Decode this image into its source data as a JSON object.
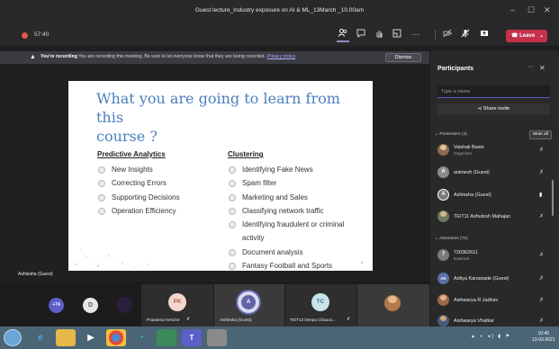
{
  "window": {
    "title": "Guest lecture_Industry exposure on AI & ML_13March _10.00am",
    "minimize": "–",
    "maximize": "☐",
    "close": "✕"
  },
  "toolbar": {
    "timer": "57:40",
    "more": "···",
    "leave_label": "Leave"
  },
  "banner": {
    "bold": "You're recording",
    "text": "You are recording this meeting. Be sure to let everyone know that they are being recorded.",
    "link": "Privacy policy",
    "dismiss": "Dismiss"
  },
  "slide": {
    "title_line1": "What you are going to learn from this",
    "title_line2": "course ?",
    "left_heading": "Predictive Analytics",
    "left_items": [
      "New Insights",
      "Correcting Errors",
      "Supporting Decisions",
      "Operation Efficiency"
    ],
    "right_heading": "Clustering",
    "right_items": [
      "Identifying Fake News",
      "Spam filter",
      "Marketing and Sales",
      "Classifying network traffic",
      "Identifying fraudulent or criminal activity",
      "Document analysis",
      "Fantasy Football and Sports"
    ],
    "page_number": "4"
  },
  "stage": {
    "presenter_label": "Ashlesha (Guest)"
  },
  "strip": {
    "overflow_count": "+74",
    "initial_d": "D",
    "initial_pk": "PK",
    "initial_a": "A",
    "initial_tc": "TC",
    "name_prasanna": "Prasanna Kenche",
    "name_ashlesha": "Ashlesha (Guest)",
    "name_deepa": "TEIT13 Deepa Chauca..."
  },
  "panel": {
    "title": "Participants",
    "more": "···",
    "close": "✕",
    "search_placeholder": "Type a name",
    "invite_label": "Share invite",
    "presenters_heading": "Presenters (4)",
    "mute_all": "Mute all",
    "attendees_heading": "Attendees (76)",
    "presenters": [
      {
        "name": "Vaishali Baste",
        "sub": "Organizer",
        "initial": ""
      },
      {
        "name": "animesh (Guest)",
        "sub": "",
        "initial": "A"
      },
      {
        "name": "Ashlesha (Guest)",
        "sub": "",
        "initial": "A"
      },
      {
        "name": "TEIT11 Ashutosh Mahajan",
        "sub": "",
        "initial": ""
      }
    ],
    "attendees": [
      {
        "name": "720362611",
        "sub": "External",
        "initial": "7"
      },
      {
        "name": "Aditya Kanawade (Guest)",
        "sub": "",
        "initial": "AK"
      },
      {
        "name": "Aishwarya R Jadhav",
        "sub": "",
        "initial": ""
      },
      {
        "name": "Aishwarya Vhatkar",
        "sub": "",
        "initial": ""
      }
    ]
  },
  "taskbar": {
    "time": "10:40",
    "date": "13-03-2021"
  },
  "colors": {
    "accent": "#5b5fc7",
    "leave": "#c4314b",
    "slide_title": "#4a7fbe"
  }
}
